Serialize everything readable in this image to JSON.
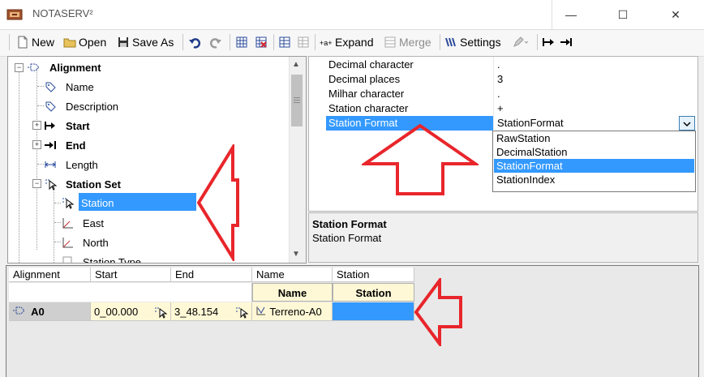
{
  "window": {
    "title": "NOTASERV²",
    "minimize": "—",
    "maximize": "☐",
    "close": "✕"
  },
  "toolbar": {
    "new_label": "New",
    "open_label": "Open",
    "save_as_label": "Save As",
    "expand_label": "Expand",
    "merge_label": "Merge",
    "settings_label": "Settings"
  },
  "tree": {
    "root": "Alignment",
    "items": [
      {
        "label": "Name"
      },
      {
        "label": "Description"
      },
      {
        "label": "Start"
      },
      {
        "label": "End"
      },
      {
        "label": "Length"
      },
      {
        "label": "Station Set"
      },
      {
        "label": "Station"
      },
      {
        "label": "East"
      },
      {
        "label": "North"
      },
      {
        "label": "Station Type"
      }
    ],
    "selected": "Station"
  },
  "properties": {
    "rows": [
      {
        "name": "Decimal character",
        "value": "."
      },
      {
        "name": "Decimal places",
        "value": "3"
      },
      {
        "name": "Milhar character",
        "value": "."
      },
      {
        "name": "Station character",
        "value": "+"
      },
      {
        "name": "Station Format",
        "value": "StationFormat"
      }
    ],
    "dropdown_options": [
      "RawStation",
      "DecimalStation",
      "StationFormat",
      "StationIndex"
    ],
    "selected_option": "StationFormat"
  },
  "description": {
    "title": "Station Format",
    "text": "Station Format"
  },
  "grid": {
    "headers": [
      "Alignment",
      "Start",
      "End",
      "Name",
      "Station"
    ],
    "subheaders": [
      "Name",
      "Station"
    ],
    "row": {
      "alignment": "A0",
      "start": "0_00.000",
      "end": "3_48.154",
      "name": "Terreno-A0",
      "station": ""
    }
  },
  "colors": {
    "selection": "#3399ff",
    "arrow": "#e8262b",
    "cell_yellow": "#fff8d6",
    "window_bg": "#f0f0f0"
  }
}
